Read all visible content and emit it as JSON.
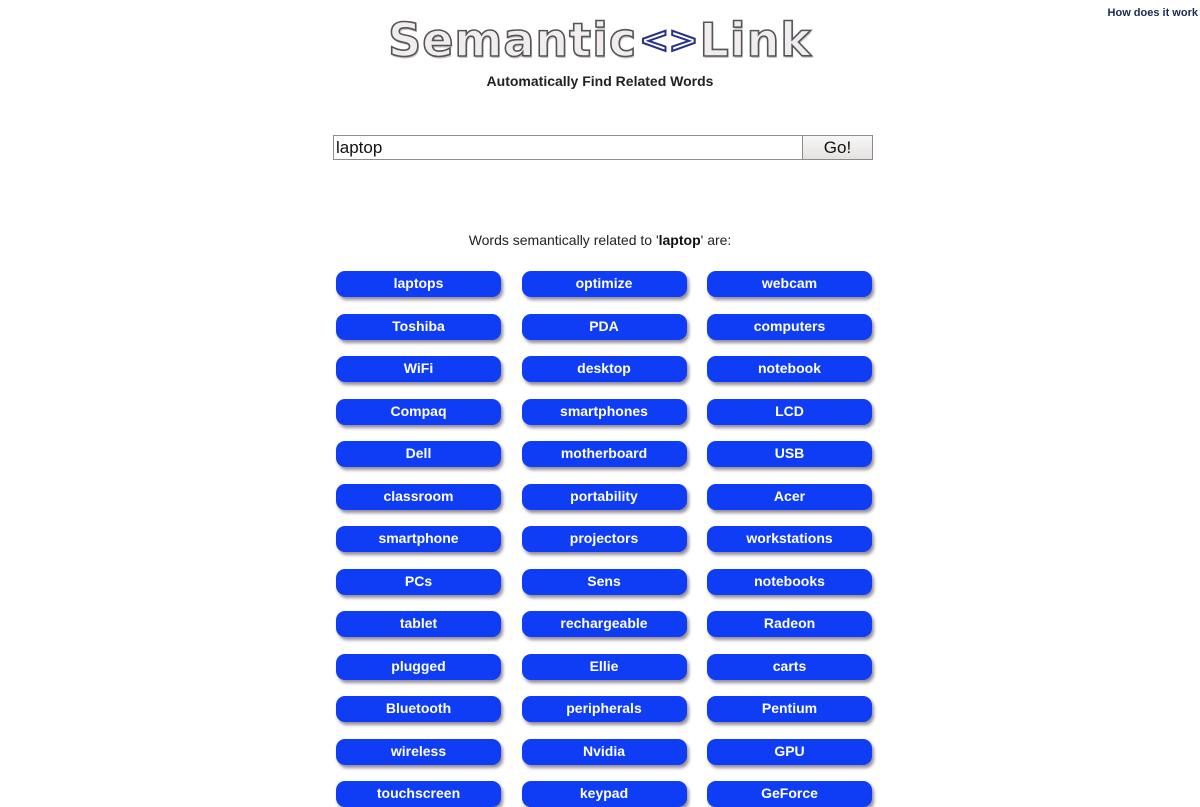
{
  "header": {
    "how_link": "How does it work",
    "logo_left": "Semantic",
    "logo_arrows": "<>",
    "logo_right": "Link",
    "tagline": "Automatically Find Related Words"
  },
  "search": {
    "value": "laptop",
    "go_label": "Go!"
  },
  "results": {
    "prefix": "Words semantically related to '",
    "query": "laptop",
    "suffix": "' are:",
    "words": [
      "laptops",
      "optimize",
      "webcam",
      "Toshiba",
      "PDA",
      "computers",
      "WiFi",
      "desktop",
      "notebook",
      "Compaq",
      "smartphones",
      "LCD",
      "Dell",
      "motherboard",
      "USB",
      "classroom",
      "portability",
      "Acer",
      "smartphone",
      "projectors",
      "workstations",
      "PCs",
      "Sens",
      "notebooks",
      "tablet",
      "rechargeable",
      "Radeon",
      "plugged",
      "Ellie",
      "carts",
      "Bluetooth",
      "peripherals",
      "Pentium",
      "wireless",
      "Nvidia",
      "GPU",
      "touchscreen",
      "keypad",
      "GeForce"
    ]
  },
  "colors": {
    "button_blue": "#0f3cf5",
    "logo_arrow_blue": "#27318a"
  }
}
